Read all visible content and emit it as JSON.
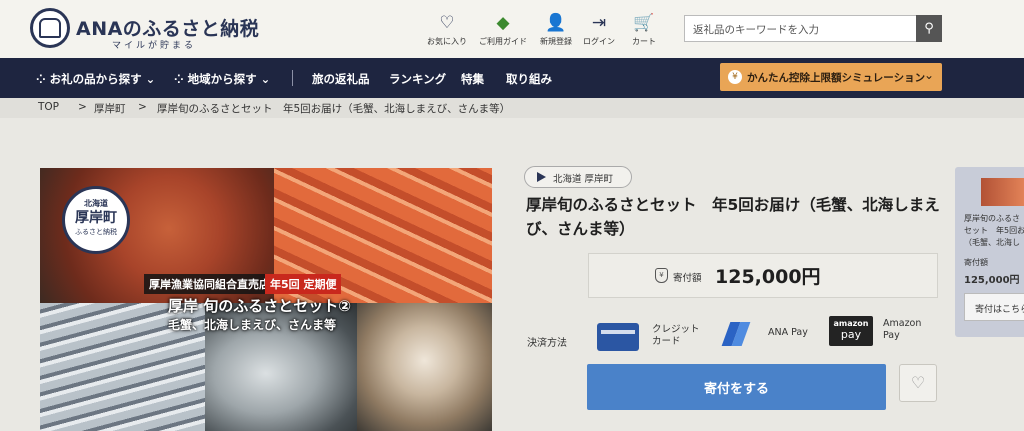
{
  "header": {
    "brand": "ANAのふるさと納税",
    "tagline": "マイルが貯まる",
    "icons": [
      {
        "label": "お気に入り",
        "icon": "heart-icon",
        "glyph": "♡"
      },
      {
        "label": "ご利用ガイド",
        "icon": "guide-icon",
        "glyph": "◆"
      },
      {
        "label": "新規登録",
        "icon": "user-add-icon",
        "glyph": "👤"
      },
      {
        "label": "ログイン",
        "icon": "login-icon",
        "glyph": "⇥"
      },
      {
        "label": "カート",
        "icon": "cart-icon",
        "glyph": "🛒"
      }
    ],
    "search_placeholder": "返礼品のキーワードを入力"
  },
  "nav": {
    "items": [
      "お礼の品から探す",
      "地域から探す",
      "旅の返礼品",
      "ランキング",
      "特集",
      "取り組み"
    ],
    "simulation": "かんたん控除上限額シミュレーション"
  },
  "breadcrumb": [
    "TOP",
    "厚岸町",
    "厚岸旬のふるさとセット　年5回お届け（毛蟹、北海しまえび、さんま等）"
  ],
  "product_image": {
    "seal_top": "北海道",
    "seal_town": "厚岸町",
    "seal_sub": "ふるさと納税",
    "label_shop": "厚岸漁業協同組合直売店",
    "label_periodic": "年5回 定期便",
    "label_title": "厚岸 旬のふるさとセット②",
    "label_items": "毛蟹、北海しまえび、さんま等"
  },
  "product": {
    "region": "北海道 厚岸町",
    "title": "厚岸旬のふるさとセット　年5回お届け（毛蟹、北海しまえび、さんま等）",
    "donation_label": "寄付額",
    "donation_amount": "125,000円",
    "payment_label": "決済方法",
    "payments": {
      "credit_line1": "クレジット",
      "credit_line2": "カード",
      "ana": "ANA Pay",
      "amazon_logo1": "amazon",
      "amazon_logo2": "pay",
      "amazon_line1": "Amazon",
      "amazon_line2": "Pay"
    },
    "donate_button": "寄付をする"
  },
  "side_card": {
    "line1": "厚岸旬のふるさ",
    "line2": "セット　年5回お",
    "line3": "（毛蟹、北海し",
    "amount_label": "寄付額",
    "amount": "125,000円",
    "button": "寄付はこちら"
  },
  "colors": {
    "navy": "#1e2540",
    "accent_orange": "#e9a556",
    "donate_blue": "#4a82c9"
  }
}
